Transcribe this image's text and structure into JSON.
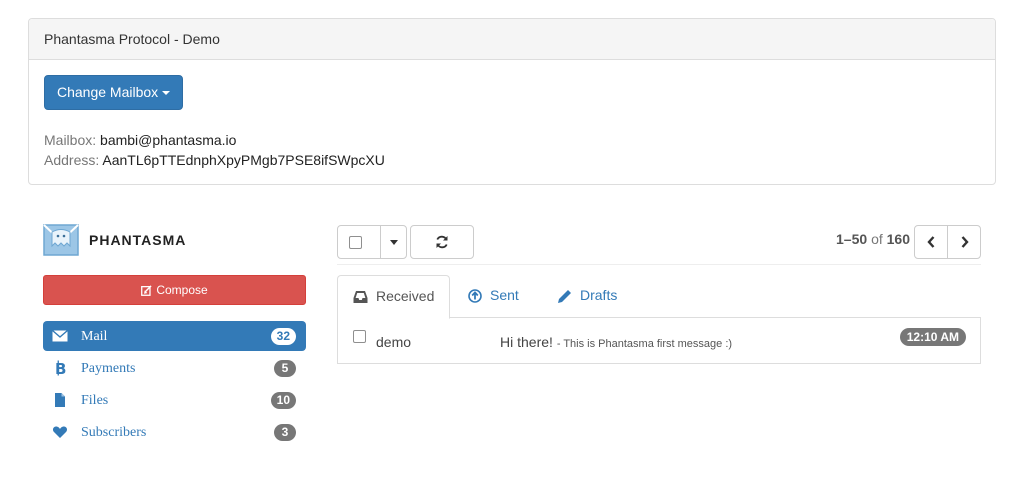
{
  "panel": {
    "title": "Phantasma Protocol - Demo",
    "change_button": "Change Mailbox",
    "mailbox_label": "Mailbox:",
    "mailbox_value": "bambi@phantasma.io",
    "address_label": "Address:",
    "address_value": "AanTL6pTTEdnphXpyPMgb7PSE8ifSWpcXU"
  },
  "brand": {
    "name": "PHANTASMA",
    "logo_icon": "phantasma-ghost-envelope-logo"
  },
  "compose": {
    "label": "Compose",
    "icon": "edit-icon"
  },
  "nav": {
    "items": [
      {
        "label": "Mail",
        "count": "32",
        "icon": "envelope-icon",
        "active": true
      },
      {
        "label": "Payments",
        "count": "5",
        "icon": "bitcoin-icon"
      },
      {
        "label": "Files",
        "count": "10",
        "icon": "file-icon"
      },
      {
        "label": "Subscribers",
        "count": "3",
        "icon": "heart-icon"
      }
    ]
  },
  "pager": {
    "range": "1–50",
    "of": "of",
    "total": "160"
  },
  "tabs": [
    {
      "label": "Received",
      "icon": "inbox-icon",
      "active": true
    },
    {
      "label": "Sent",
      "icon": "circle-arrow-up-icon"
    },
    {
      "label": "Drafts",
      "icon": "pencil-icon"
    }
  ],
  "messages": [
    {
      "from": "demo",
      "subject": "Hi there!",
      "preview": "- This is Phantasma first message :)",
      "time": "12:10 AM"
    }
  ],
  "colors": {
    "primary": "#337ab7",
    "danger": "#d9534f",
    "badge": "#777777"
  }
}
